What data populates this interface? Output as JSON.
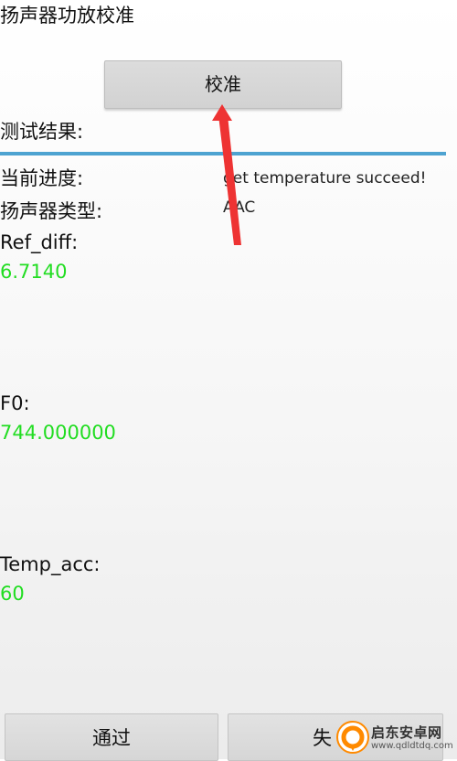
{
  "header": {
    "title": "扬声器功放校准"
  },
  "calibrate_button": {
    "label": "校准"
  },
  "test_result": {
    "label": "测试结果:"
  },
  "status_rows": [
    {
      "label": "当前进度:",
      "value": "get temperature succeed!"
    },
    {
      "label": "扬声器类型:",
      "value": "AAC"
    }
  ],
  "metrics": [
    {
      "label": "Ref_diff:",
      "value": "6.7140"
    },
    {
      "label": "F0:",
      "value": "744.000000"
    },
    {
      "label": "Temp_acc:",
      "value": "60"
    }
  ],
  "footer": {
    "pass_label": "通过",
    "fail_label": "失"
  },
  "watermark": {
    "name": "启东安卓网",
    "url": "www.qdldtdq.com"
  },
  "colors": {
    "divider": "#4ea3d1",
    "metric_value": "#22dd22",
    "annotation_arrow": "#ee3333",
    "watermark_logo": "#ff8a00"
  }
}
